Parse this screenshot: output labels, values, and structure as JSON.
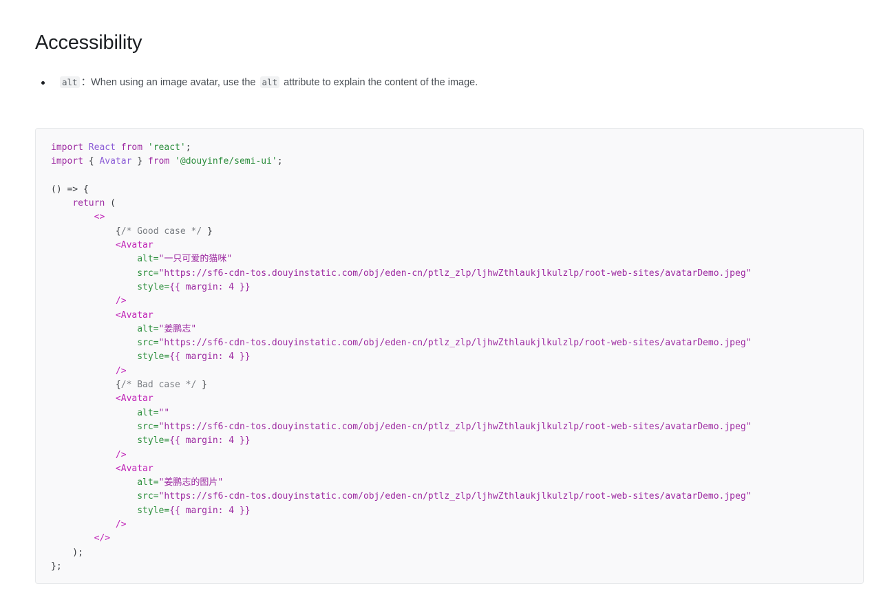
{
  "section": {
    "heading": "Accessibility",
    "bullets": [
      {
        "code1": "alt",
        "text1": "：When using an image avatar, use the",
        "code2": "alt",
        "text2": "attribute to explain the content of the image."
      }
    ]
  },
  "code_block": {
    "lines": [
      [
        {
          "t": "import",
          "k": "keyword"
        },
        {
          "t": " ",
          "k": "plain"
        },
        {
          "t": "React",
          "k": "ident"
        },
        {
          "t": " ",
          "k": "plain"
        },
        {
          "t": "from",
          "k": "keyword"
        },
        {
          "t": " ",
          "k": "plain"
        },
        {
          "t": "'react'",
          "k": "string"
        },
        {
          "t": ";",
          "k": "plain"
        }
      ],
      [
        {
          "t": "import",
          "k": "keyword"
        },
        {
          "t": " { ",
          "k": "plain"
        },
        {
          "t": "Avatar",
          "k": "ident"
        },
        {
          "t": " } ",
          "k": "plain"
        },
        {
          "t": "from",
          "k": "keyword"
        },
        {
          "t": " ",
          "k": "plain"
        },
        {
          "t": "'@douyinfe/semi-ui'",
          "k": "string"
        },
        {
          "t": ";",
          "k": "plain"
        }
      ],
      [],
      [
        {
          "t": "() => {",
          "k": "plain"
        }
      ],
      [
        {
          "t": "    ",
          "k": "plain"
        },
        {
          "t": "return",
          "k": "keyword"
        },
        {
          "t": " (",
          "k": "plain"
        }
      ],
      [
        {
          "t": "        ",
          "k": "plain"
        },
        {
          "t": "<>",
          "k": "tag"
        }
      ],
      [
        {
          "t": "            {",
          "k": "plain"
        },
        {
          "t": "/* Good case */",
          "k": "comment"
        },
        {
          "t": " }",
          "k": "plain"
        }
      ],
      [
        {
          "t": "            ",
          "k": "plain"
        },
        {
          "t": "<Avatar",
          "k": "tag"
        }
      ],
      [
        {
          "t": "                ",
          "k": "plain"
        },
        {
          "t": "alt=",
          "k": "attr"
        },
        {
          "t": "\"一只可爱的猫咪\"",
          "k": "value"
        }
      ],
      [
        {
          "t": "                ",
          "k": "plain"
        },
        {
          "t": "src=",
          "k": "attr"
        },
        {
          "t": "\"https://sf6-cdn-tos.douyinstatic.com/obj/eden-cn/ptlz_zlp/ljhwZthlaukjlkulzlp/root-web-sites/avatarDemo.jpeg\"",
          "k": "value"
        }
      ],
      [
        {
          "t": "                ",
          "k": "plain"
        },
        {
          "t": "style=",
          "k": "attr"
        },
        {
          "t": "{{ margin: 4 }}",
          "k": "value"
        }
      ],
      [
        {
          "t": "            ",
          "k": "plain"
        },
        {
          "t": "/>",
          "k": "tag"
        }
      ],
      [
        {
          "t": "            ",
          "k": "plain"
        },
        {
          "t": "<Avatar",
          "k": "tag"
        }
      ],
      [
        {
          "t": "                ",
          "k": "plain"
        },
        {
          "t": "alt=",
          "k": "attr"
        },
        {
          "t": "\"姜鹏志\"",
          "k": "value"
        }
      ],
      [
        {
          "t": "                ",
          "k": "plain"
        },
        {
          "t": "src=",
          "k": "attr"
        },
        {
          "t": "\"https://sf6-cdn-tos.douyinstatic.com/obj/eden-cn/ptlz_zlp/ljhwZthlaukjlkulzlp/root-web-sites/avatarDemo.jpeg\"",
          "k": "value"
        }
      ],
      [
        {
          "t": "                ",
          "k": "plain"
        },
        {
          "t": "style=",
          "k": "attr"
        },
        {
          "t": "{{ margin: 4 }}",
          "k": "value"
        }
      ],
      [
        {
          "t": "            ",
          "k": "plain"
        },
        {
          "t": "/>",
          "k": "tag"
        }
      ],
      [
        {
          "t": "            {",
          "k": "plain"
        },
        {
          "t": "/* Bad case */",
          "k": "comment"
        },
        {
          "t": " }",
          "k": "plain"
        }
      ],
      [
        {
          "t": "            ",
          "k": "plain"
        },
        {
          "t": "<Avatar",
          "k": "tag"
        }
      ],
      [
        {
          "t": "                ",
          "k": "plain"
        },
        {
          "t": "alt=",
          "k": "attr"
        },
        {
          "t": "\"\"",
          "k": "value"
        }
      ],
      [
        {
          "t": "                ",
          "k": "plain"
        },
        {
          "t": "src=",
          "k": "attr"
        },
        {
          "t": "\"https://sf6-cdn-tos.douyinstatic.com/obj/eden-cn/ptlz_zlp/ljhwZthlaukjlkulzlp/root-web-sites/avatarDemo.jpeg\"",
          "k": "value"
        }
      ],
      [
        {
          "t": "                ",
          "k": "plain"
        },
        {
          "t": "style=",
          "k": "attr"
        },
        {
          "t": "{{ margin: 4 }}",
          "k": "value"
        }
      ],
      [
        {
          "t": "            ",
          "k": "plain"
        },
        {
          "t": "/>",
          "k": "tag"
        }
      ],
      [
        {
          "t": "            ",
          "k": "plain"
        },
        {
          "t": "<Avatar",
          "k": "tag"
        }
      ],
      [
        {
          "t": "                ",
          "k": "plain"
        },
        {
          "t": "alt=",
          "k": "attr"
        },
        {
          "t": "\"姜鹏志的图片\"",
          "k": "value"
        }
      ],
      [
        {
          "t": "                ",
          "k": "plain"
        },
        {
          "t": "src=",
          "k": "attr"
        },
        {
          "t": "\"https://sf6-cdn-tos.douyinstatic.com/obj/eden-cn/ptlz_zlp/ljhwZthlaukjlkulzlp/root-web-sites/avatarDemo.jpeg\"",
          "k": "value"
        }
      ],
      [
        {
          "t": "                ",
          "k": "plain"
        },
        {
          "t": "style=",
          "k": "attr"
        },
        {
          "t": "{{ margin: 4 }}",
          "k": "value"
        }
      ],
      [
        {
          "t": "            ",
          "k": "plain"
        },
        {
          "t": "/>",
          "k": "tag"
        }
      ],
      [
        {
          "t": "        ",
          "k": "plain"
        },
        {
          "t": "</>",
          "k": "tag"
        }
      ],
      [
        {
          "t": "    );",
          "k": "plain"
        }
      ],
      [
        {
          "t": "};",
          "k": "plain"
        }
      ]
    ]
  }
}
